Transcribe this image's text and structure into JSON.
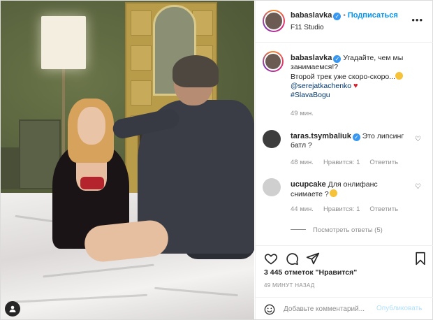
{
  "post": {
    "username": "babaslavka",
    "follow_label": "Подписаться",
    "location": "F11 Studio",
    "more_icon": "more-horizontal-icon",
    "caption": {
      "username": "babaslavka",
      "line1": "Угадайте, чем мы занимаемся!?",
      "line2": "Второй трек уже скоро-скоро...",
      "mention": "@serejatkachenko",
      "hashtag": "#SlavaBogu",
      "time": "49 мин."
    },
    "comments": [
      {
        "username": "taras.tsymbaliuk",
        "text": "Это липсинг батл ?",
        "time": "48 мин.",
        "likes": "Нравится: 1",
        "reply": "Ответить"
      },
      {
        "username": "ucupcake",
        "text": "Для онлифанс снимаете ?",
        "time": "44 мин.",
        "likes": "Нравится: 1",
        "reply": "Ответить"
      }
    ],
    "view_replies": "Посмотреть ответы (5)",
    "likes_count": "3 445 отметок \"Нравится\"",
    "ago": "49 МИНУТ НАЗАД",
    "add_comment_placeholder": "Добавьте комментарий...",
    "publish_label": "Опубликовать"
  },
  "colors": {
    "accent": "#0095f6",
    "verified": "#3897f0",
    "heart_red": "#ed4956"
  }
}
